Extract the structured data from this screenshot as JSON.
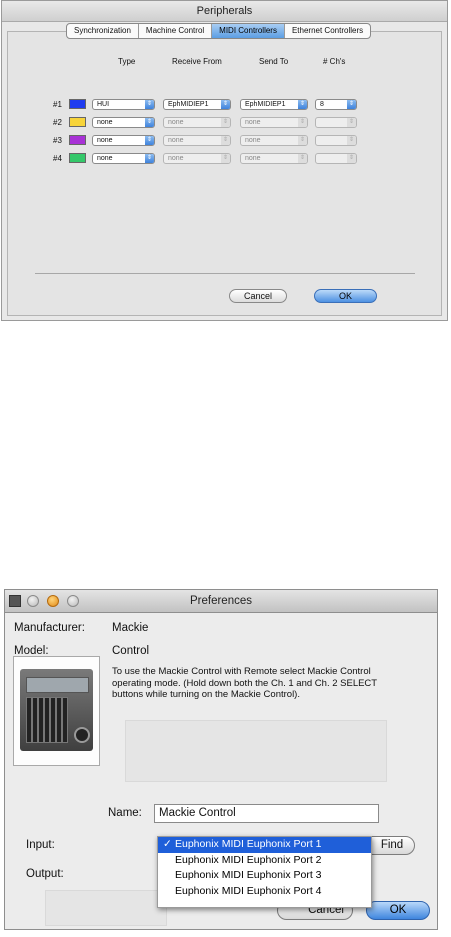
{
  "peripherals": {
    "title": "Peripherals",
    "tabs": [
      "Synchronization",
      "Machine Control",
      "MIDI Controllers",
      "Ethernet Controllers"
    ],
    "active_tab": "MIDI Controllers",
    "columns": [
      "Type",
      "Receive From",
      "Send To",
      "# Ch's"
    ],
    "rows": [
      {
        "label": "#1",
        "color": "#1f3cf0",
        "type": "HUI",
        "receive": "EphMIDIEP1",
        "send": "EphMIDIEP1",
        "channels": "8",
        "enabled": true
      },
      {
        "label": "#2",
        "color": "#f7d43a",
        "type": "none",
        "receive": "none",
        "send": "none",
        "channels": "",
        "enabled": false
      },
      {
        "label": "#3",
        "color": "#a832d6",
        "type": "none",
        "receive": "none",
        "send": "none",
        "channels": "",
        "enabled": false
      },
      {
        "label": "#4",
        "color": "#34c86a",
        "type": "none",
        "receive": "none",
        "send": "none",
        "channels": "",
        "enabled": false
      }
    ],
    "cancel_label": "Cancel",
    "ok_label": "OK"
  },
  "preferences": {
    "title": "Preferences",
    "manufacturer_label": "Manufacturer:",
    "manufacturer_value": "Mackie",
    "model_label": "Model:",
    "model_value": "Control",
    "description": "To use the Mackie Control with Remote select Mackie Control operating mode. (Hold down both the Ch. 1 and Ch. 2 SELECT buttons while turning on the Mackie Control).",
    "name_label": "Name:",
    "name_value": "Mackie Control",
    "input_label": "Input:",
    "output_label": "Output:",
    "find_label": "Find",
    "cancel_label": "Cancel",
    "ok_label": "OK",
    "menu_items": [
      {
        "label": "Euphonix MIDI Euphonix Port 1",
        "checked": true
      },
      {
        "label": "Euphonix MIDI Euphonix Port 2",
        "checked": false
      },
      {
        "label": "Euphonix MIDI Euphonix Port 3",
        "checked": false
      },
      {
        "label": "Euphonix MIDI Euphonix Port 4",
        "checked": false
      }
    ],
    "checkmark": "✓"
  }
}
